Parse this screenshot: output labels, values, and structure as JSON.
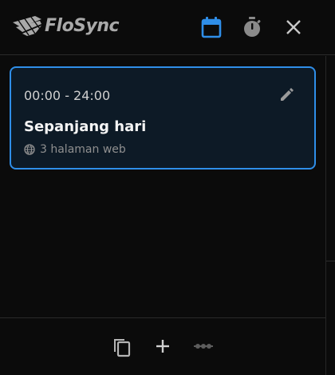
{
  "app": {
    "name": "FloSync"
  },
  "header": {
    "icons": {
      "calendar": "calendar-icon",
      "timer": "timer-icon",
      "close": "close-icon"
    },
    "accent_color": "#2f8ee8"
  },
  "schedule": {
    "items": [
      {
        "time_range": "00:00 - 24:00",
        "title": "Sepanjang hari",
        "meta": "3 halaman web",
        "selected": true
      }
    ]
  },
  "footer": {
    "icons": {
      "copy": "copy-icon",
      "add": "add-icon",
      "more": "more-icon"
    }
  },
  "colors": {
    "background": "#0b0b0b",
    "card_background": "#0d1a26",
    "card_border": "#2f8ee8",
    "muted_icon": "#8a8a8a"
  }
}
